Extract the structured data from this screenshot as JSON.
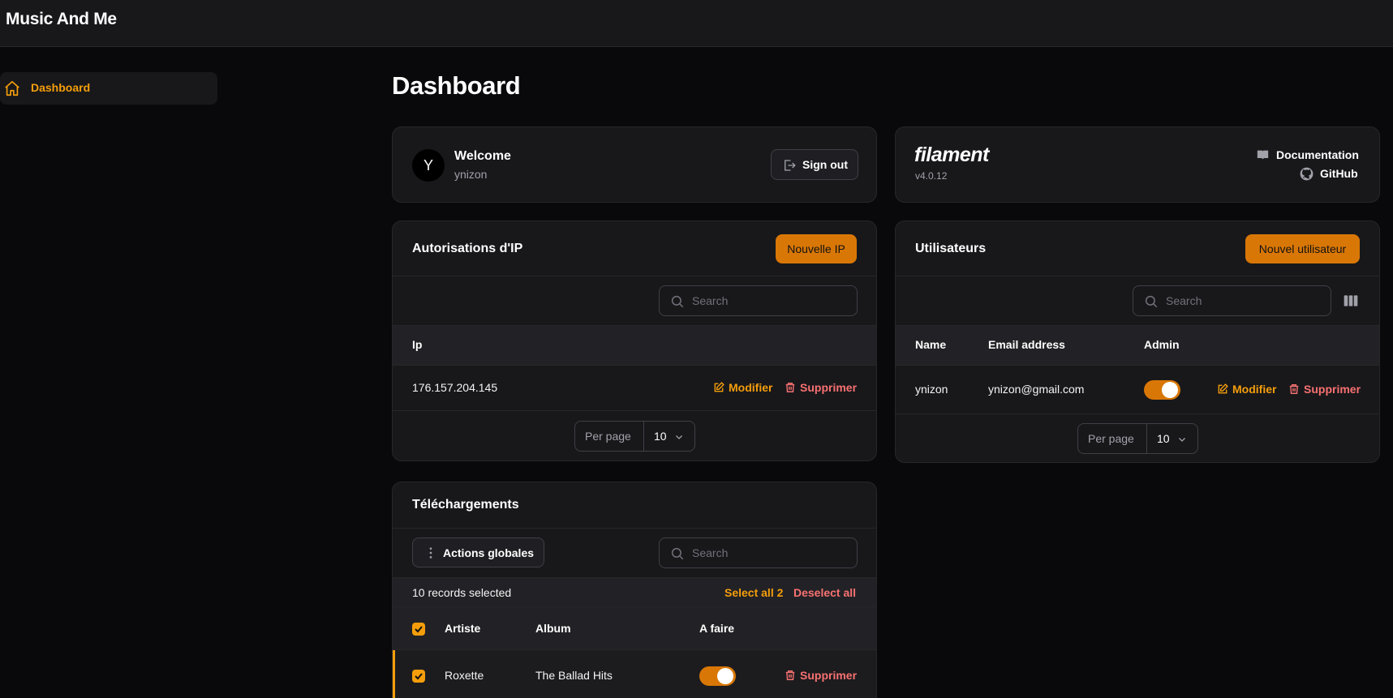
{
  "app": {
    "title": "Music And Me"
  },
  "sidebar": {
    "items": [
      {
        "label": "Dashboard",
        "icon": "home-icon",
        "active": true
      }
    ]
  },
  "page": {
    "title": "Dashboard"
  },
  "account": {
    "avatar_initial": "Y",
    "welcome": "Welcome",
    "username": "ynizon",
    "sign_out": "Sign out"
  },
  "filament": {
    "logo": "filament",
    "version": "v4.0.12",
    "documentation": "Documentation",
    "github": "GitHub"
  },
  "ip_table": {
    "title": "Autorisations d'IP",
    "new_button": "Nouvelle IP",
    "search_placeholder": "Search",
    "columns": [
      "Ip"
    ],
    "rows": [
      {
        "ip": "176.157.204.145",
        "edit": "Modifier",
        "delete": "Supprimer"
      }
    ],
    "per_page_label": "Per page",
    "per_page_value": "10"
  },
  "users_table": {
    "title": "Utilisateurs",
    "new_button": "Nouvel utilisateur",
    "search_placeholder": "Search",
    "columns": [
      "Name",
      "Email address",
      "Admin"
    ],
    "rows": [
      {
        "name": "ynizon",
        "email": "ynizon@gmail.com",
        "admin": true,
        "edit": "Modifier",
        "delete": "Supprimer"
      }
    ],
    "per_page_label": "Per page",
    "per_page_value": "10"
  },
  "downloads_table": {
    "title": "Téléchargements",
    "bulk_actions": "Actions globales",
    "search_placeholder": "Search",
    "selection_text": "10 records selected",
    "select_all": "Select all 2",
    "deselect_all": "Deselect all",
    "columns": [
      "Artiste",
      "Album",
      "A faire"
    ],
    "rows": [
      {
        "artist": "Roxette",
        "album": "The Ballad Hits",
        "todo": true,
        "delete": "Supprimer",
        "selected": true
      }
    ]
  },
  "colors": {
    "accent": "#f59e0b",
    "button": "#d97706",
    "danger": "#f87171",
    "background": "#09090b",
    "card": "#18181b"
  }
}
